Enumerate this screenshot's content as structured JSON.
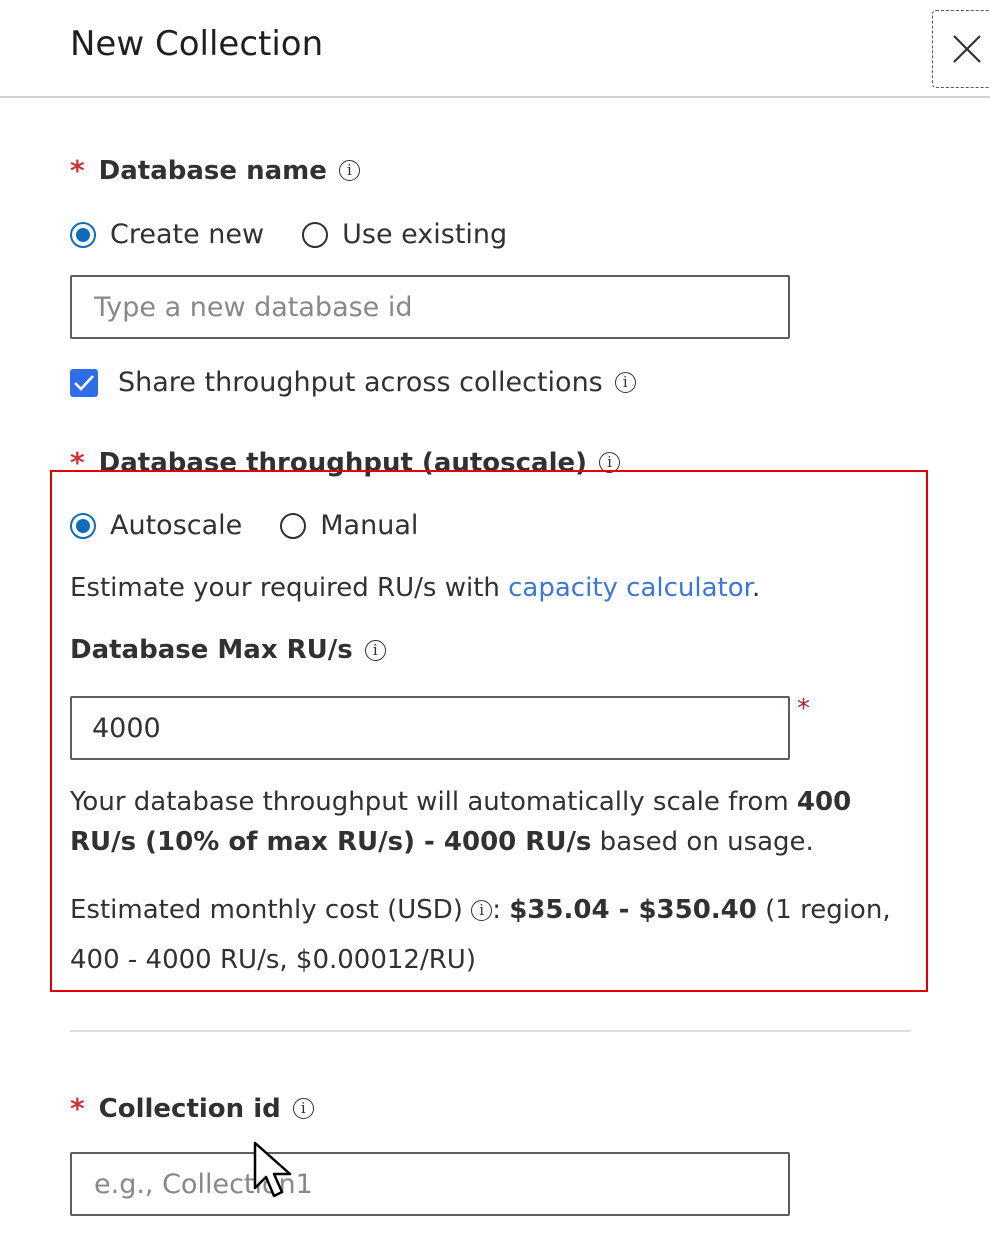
{
  "header": {
    "title": "New Collection",
    "close_icon": "close-icon"
  },
  "database_name": {
    "label": "Database name",
    "required_mark": "*",
    "info_icon": "i",
    "options": [
      {
        "label": "Create new",
        "checked": true
      },
      {
        "label": "Use existing",
        "checked": false
      }
    ],
    "input_value": "",
    "input_placeholder": "Type a new database id"
  },
  "share_throughput": {
    "label": "Share throughput across collections",
    "checked": true,
    "info_icon": "i"
  },
  "database_throughput": {
    "label": "Database throughput (autoscale)",
    "required_mark": "*",
    "info_icon": "i",
    "options": [
      {
        "label": "Autoscale",
        "checked": true
      },
      {
        "label": "Manual",
        "checked": false
      }
    ],
    "estimate_prefix": "Estimate your required RU/s with ",
    "estimate_link": "capacity calculator",
    "estimate_suffix": ".",
    "max_ru": {
      "label": "Database Max RU/s",
      "info_icon": "i",
      "value": "4000",
      "required_mark": "*"
    },
    "scale_text": {
      "prefix": "Your database throughput will automatically scale from ",
      "bold": "400 RU/s (10% of max RU/s) - 4000 RU/s",
      "suffix": " based on usage."
    },
    "cost": {
      "prefix": "Estimated monthly cost (USD) ",
      "info_icon": "i",
      "colon": ": ",
      "bold": "$35.04 - $350.40",
      "details": " (1 region, 400 - 4000 RU/s, $0.00012/RU)"
    }
  },
  "collection_id": {
    "label": "Collection id",
    "required_mark": "*",
    "info_icon": "i",
    "input_value": "",
    "input_placeholder": "e.g., Collection1"
  },
  "colors": {
    "accent": "#0f6cbd",
    "checkbox": "#2f6ee8",
    "required": "#d13438",
    "link": "#3b78d8",
    "highlight": "#e00000"
  }
}
